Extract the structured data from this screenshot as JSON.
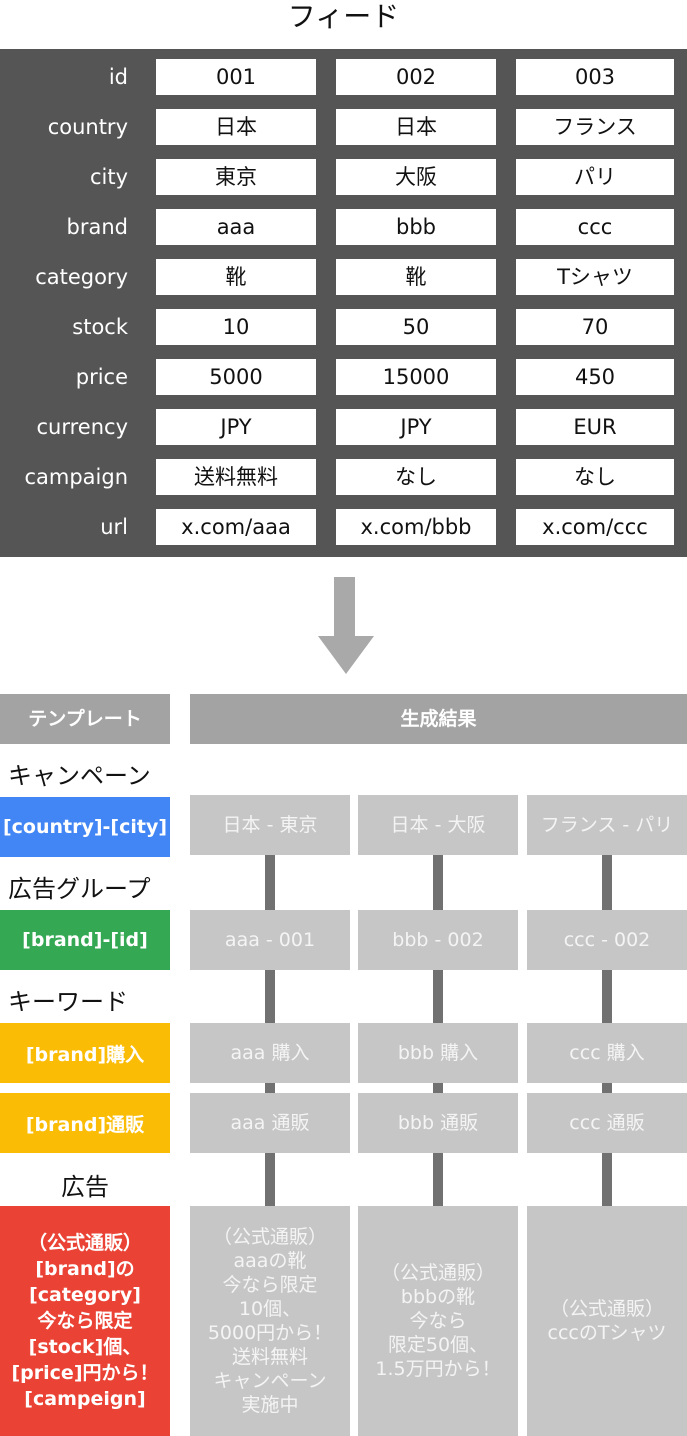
{
  "feed": {
    "title": "フィード",
    "rows": [
      {
        "label": "id",
        "values": [
          "001",
          "002",
          "003"
        ]
      },
      {
        "label": "country",
        "values": [
          "日本",
          "日本",
          "フランス"
        ]
      },
      {
        "label": "city",
        "values": [
          "東京",
          "大阪",
          "パリ"
        ]
      },
      {
        "label": "brand",
        "values": [
          "aaa",
          "bbb",
          "ccc"
        ]
      },
      {
        "label": "category",
        "values": [
          "靴",
          "靴",
          "Tシャツ"
        ]
      },
      {
        "label": "stock",
        "values": [
          "10",
          "50",
          "70"
        ]
      },
      {
        "label": "price",
        "values": [
          "5000",
          "15000",
          "450"
        ]
      },
      {
        "label": "currency",
        "values": [
          "JPY",
          "JPY",
          "EUR"
        ]
      },
      {
        "label": "campaign",
        "values": [
          "送料無料",
          "なし",
          "なし"
        ]
      },
      {
        "label": "url",
        "values": [
          "x.com/aaa",
          "x.com/bbb",
          "x.com/ccc"
        ]
      }
    ]
  },
  "arrow_icon": "down-arrow-icon",
  "headers": {
    "template": "テンプレート",
    "results": "生成結果"
  },
  "sections": {
    "campaign": {
      "label": "キャンペーン",
      "template": "[country]-[city]",
      "color": "#4285f4",
      "results": [
        "日本 - 東京",
        "日本 - 大阪",
        "フランス - パリ"
      ]
    },
    "adgroup": {
      "label": "広告グループ",
      "template": "[brand]-[id]",
      "color": "#34a853",
      "results": [
        "aaa - 001",
        "bbb - 002",
        "ccc - 002"
      ]
    },
    "keyword": {
      "label": "キーワード",
      "color": "#fbbc05",
      "rows": [
        {
          "template": "[brand]購入",
          "results": [
            "aaa 購入",
            "bbb 購入",
            "ccc 購入"
          ]
        },
        {
          "template": "[brand]通販",
          "results": [
            "aaa 通販",
            "bbb 通販",
            "ccc 通販"
          ]
        }
      ]
    },
    "ad": {
      "label": "広告",
      "template": "（公式通販）\n[brand]の\n[category]\n今なら限定\n[stock]個、\n[price]円から！\n[campeign]",
      "color": "#ea4335",
      "results": [
        "（公式通販）\naaaの靴\n今なら限定\n10個、\n5000円から！\n送料無料\nキャンペーン\n実施中",
        "（公式通販）\nbbbの靴\n今なら\n限定50個、\n1.5万円から！",
        "（公式通販）\ncccのTシャツ"
      ]
    }
  }
}
